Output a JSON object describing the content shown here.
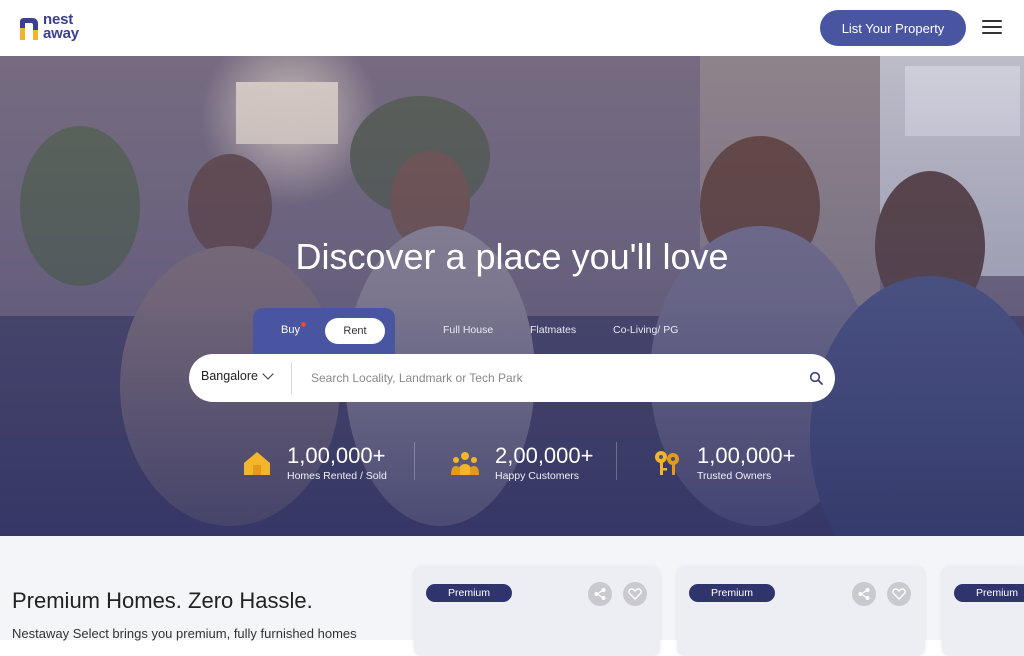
{
  "header": {
    "logo_line1": "nest",
    "logo_line2": "away",
    "list_property_label": "List Your Property",
    "brand_color": "#4a55a2"
  },
  "hero": {
    "title": "Discover a place you'll love",
    "mode_tabs": [
      {
        "label": "Buy",
        "selected": false
      },
      {
        "label": "Rent",
        "selected": true
      }
    ],
    "type_tabs": [
      {
        "label": "Full House"
      },
      {
        "label": "Flatmates"
      },
      {
        "label": "Co-Living/ PG"
      }
    ],
    "search": {
      "city": "Bangalore",
      "placeholder": "Search Locality, Landmark or Tech Park"
    },
    "stats": [
      {
        "value": "1,00,000+",
        "label": "Homes Rented / Sold",
        "icon": "house-icon"
      },
      {
        "value": "2,00,000+",
        "label": "Happy Customers",
        "icon": "customers-icon"
      },
      {
        "value": "1,00,000+",
        "label": "Trusted Owners",
        "icon": "keys-icon"
      }
    ]
  },
  "section": {
    "title": "Premium Homes. Zero Hassle.",
    "description": "Nestaway Select brings you premium, fully furnished homes",
    "cards": [
      {
        "badge": "Premium"
      },
      {
        "badge": "Premium"
      },
      {
        "badge": "Premium"
      }
    ]
  }
}
